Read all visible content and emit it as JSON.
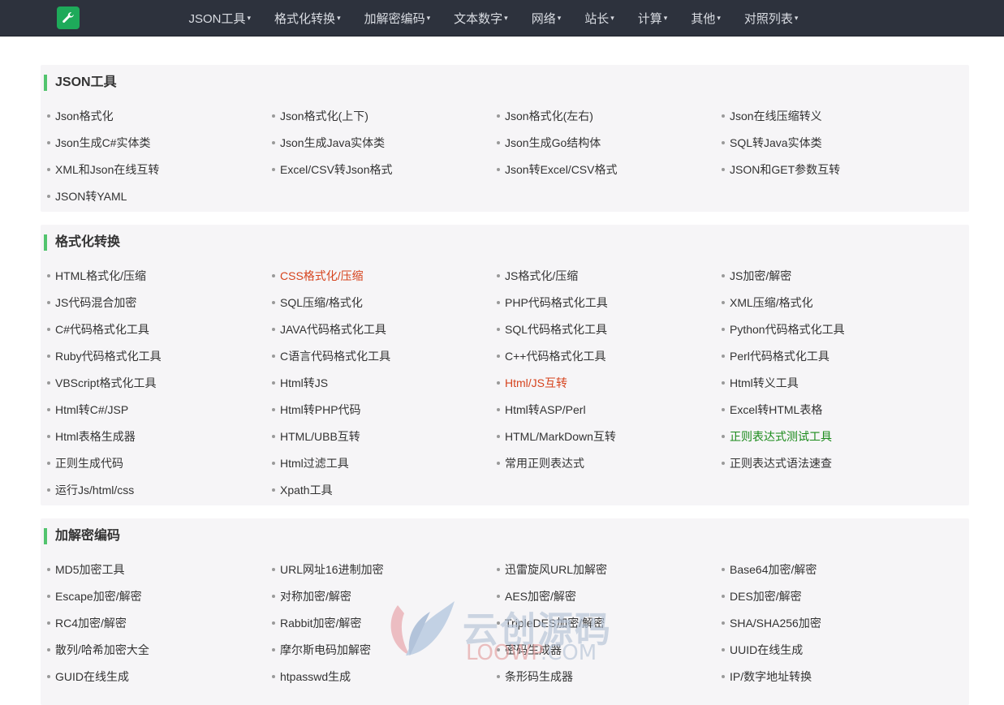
{
  "nav": {
    "logo_icon": "wrench-icon",
    "items": [
      {
        "label": "JSON工具"
      },
      {
        "label": "格式化转换"
      },
      {
        "label": "加解密编码"
      },
      {
        "label": "文本数字"
      },
      {
        "label": "网络"
      },
      {
        "label": "站长"
      },
      {
        "label": "计算"
      },
      {
        "label": "其他"
      },
      {
        "label": "对照列表"
      }
    ]
  },
  "sections": [
    {
      "title": "JSON工具",
      "items": [
        {
          "label": "Json格式化"
        },
        {
          "label": "Json格式化(上下)"
        },
        {
          "label": "Json格式化(左右)"
        },
        {
          "label": "Json在线压缩转义"
        },
        {
          "label": "Json生成C#实体类"
        },
        {
          "label": "Json生成Java实体类"
        },
        {
          "label": "Json生成Go结构体"
        },
        {
          "label": "SQL转Java实体类"
        },
        {
          "label": "XML和Json在线互转"
        },
        {
          "label": "Excel/CSV转Json格式"
        },
        {
          "label": "Json转Excel/CSV格式"
        },
        {
          "label": "JSON和GET参数互转"
        },
        {
          "label": "JSON转YAML"
        }
      ]
    },
    {
      "title": "格式化转换",
      "items": [
        {
          "label": "HTML格式化/压缩"
        },
        {
          "label": "CSS格式化/压缩",
          "color": "orange"
        },
        {
          "label": "JS格式化/压缩"
        },
        {
          "label": "JS加密/解密"
        },
        {
          "label": "JS代码混合加密"
        },
        {
          "label": "SQL压缩/格式化"
        },
        {
          "label": "PHP代码格式化工具"
        },
        {
          "label": "XML压缩/格式化"
        },
        {
          "label": "C#代码格式化工具"
        },
        {
          "label": "JAVA代码格式化工具"
        },
        {
          "label": "SQL代码格式化工具"
        },
        {
          "label": "Python代码格式化工具"
        },
        {
          "label": "Ruby代码格式化工具"
        },
        {
          "label": "C语言代码格式化工具"
        },
        {
          "label": "C++代码格式化工具"
        },
        {
          "label": "Perl代码格式化工具"
        },
        {
          "label": "VBScript格式化工具"
        },
        {
          "label": "Html转JS"
        },
        {
          "label": "Html/JS互转",
          "color": "orange"
        },
        {
          "label": "Html转义工具"
        },
        {
          "label": "Html转C#/JSP"
        },
        {
          "label": "Html转PHP代码"
        },
        {
          "label": "Html转ASP/Perl"
        },
        {
          "label": "Excel转HTML表格"
        },
        {
          "label": "Html表格生成器"
        },
        {
          "label": "HTML/UBB互转"
        },
        {
          "label": "HTML/MarkDown互转"
        },
        {
          "label": "正则表达式测试工具",
          "color": "green"
        },
        {
          "label": "正则生成代码"
        },
        {
          "label": "Html过滤工具"
        },
        {
          "label": "常用正则表达式"
        },
        {
          "label": "正则表达式语法速查"
        },
        {
          "label": "运行Js/html/css"
        },
        {
          "label": "Xpath工具"
        }
      ]
    },
    {
      "title": "加解密编码",
      "items": [
        {
          "label": "MD5加密工具"
        },
        {
          "label": "URL网址16进制加密"
        },
        {
          "label": "迅雷旋风URL加解密"
        },
        {
          "label": "Base64加密/解密"
        },
        {
          "label": "Escape加密/解密"
        },
        {
          "label": "对称加密/解密"
        },
        {
          "label": "AES加密/解密"
        },
        {
          "label": "DES加密/解密"
        },
        {
          "label": "RC4加密/解密"
        },
        {
          "label": "Rabbit加密/解密"
        },
        {
          "label": "TripleDES加密/解密"
        },
        {
          "label": "SHA/SHA256加密"
        },
        {
          "label": "散列/哈希加密大全"
        },
        {
          "label": "摩尔斯电码加解密"
        },
        {
          "label": "密码生成器"
        },
        {
          "label": "UUID在线生成"
        },
        {
          "label": "GUID在线生成"
        },
        {
          "label": "htpasswd生成"
        },
        {
          "label": "条形码生成器"
        },
        {
          "label": "IP/数字地址转换"
        }
      ]
    }
  ],
  "watermark": {
    "title": "云创源码",
    "sub_a": "LOOWP",
    "sub_b": ".COM"
  },
  "colors": {
    "topbar": "#2d323d",
    "accent": "#52c46e",
    "orange": "#d6441e",
    "green": "#1a8a1a",
    "section_bg": "#f6f5f7"
  }
}
